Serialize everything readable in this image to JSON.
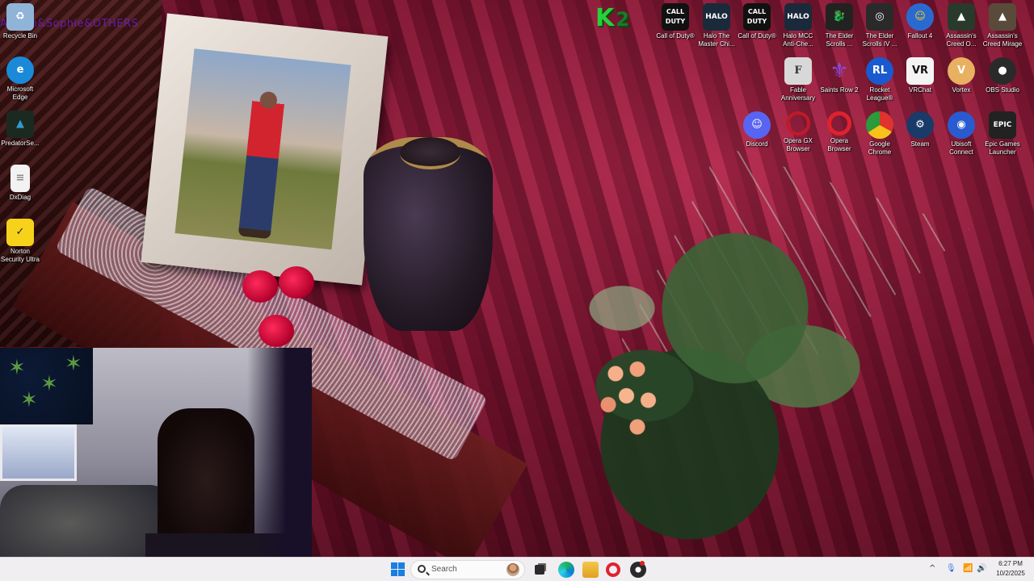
{
  "overlay_text": "Allison&Sophie&OTHERS",
  "logo": {
    "k": "K",
    "two": "2"
  },
  "desktop_left_icons": [
    {
      "name": "recycle-bin",
      "label": "Recycle Bin",
      "icon": "recycle-bin-icon",
      "color": "#8fb4d8"
    },
    {
      "name": "microsoft-edge",
      "label": "Microsoft Edge",
      "icon": "edge-icon",
      "color": "#1a8ad8"
    },
    {
      "name": "predatorsense",
      "label": "PredatorSe...",
      "icon": "predator-icon",
      "color": "#1a2a20"
    },
    {
      "name": "dxdiag",
      "label": "DxDiag",
      "icon": "document-icon",
      "color": "#f2f2f2"
    },
    {
      "name": "norton",
      "label": "Norton Security Ultra",
      "icon": "norton-icon",
      "color": "#f7d21a"
    }
  ],
  "desktop_right_row1": [
    {
      "name": "cod-1",
      "label": "Call of Duty®",
      "glyph": "CALL DUTY",
      "color": "#111111"
    },
    {
      "name": "halo-master-chief",
      "label": "Halo The Master Chi...",
      "glyph": "HALO",
      "color": "#1a2a3a"
    },
    {
      "name": "cod-2",
      "label": "Call of Duty®",
      "glyph": "CALL DUTY",
      "color": "#111111"
    },
    {
      "name": "halo-mcc-anticheat",
      "label": "Halo MCC Anti-Che...",
      "glyph": "HALO",
      "color": "#1a2a3a"
    },
    {
      "name": "elder-scrolls-1",
      "label": "The Elder Scrolls ...",
      "glyph": "ES",
      "color": "#222222"
    },
    {
      "name": "elder-scrolls-4",
      "label": "The Elder Scrolls IV ...",
      "glyph": "IV",
      "color": "#2a2a2a"
    },
    {
      "name": "fallout-4",
      "label": "Fallout 4",
      "glyph": "F4",
      "color": "#2a6ad0"
    },
    {
      "name": "assassins-creed-o",
      "label": "Assassin's Creed O...",
      "glyph": "AC",
      "color": "#2a3a2a"
    },
    {
      "name": "assassins-creed-mirage",
      "label": "Assassin's Creed Mirage",
      "glyph": "AC",
      "color": "#5a4a3a"
    }
  ],
  "desktop_right_row2": [
    {
      "name": "fable",
      "label": "Fable Anniversary",
      "glyph": "F",
      "color": "#d8d8d8"
    },
    {
      "name": "saints-row-2",
      "label": "Saints Row 2",
      "glyph": "⚜",
      "color": "#5a2a9a"
    },
    {
      "name": "rocket-league",
      "label": "Rocket League®",
      "glyph": "RL",
      "color": "#1a5ad0"
    },
    {
      "name": "vrchat",
      "label": "VRChat",
      "glyph": "VR",
      "color": "#f4f4f4"
    },
    {
      "name": "vortex",
      "label": "Vortex",
      "glyph": "V",
      "color": "#e8b060"
    },
    {
      "name": "obs-studio",
      "label": "OBS Studio",
      "glyph": "●",
      "color": "#2a2a2a"
    }
  ],
  "desktop_right_row3": [
    {
      "name": "discord",
      "label": "Discord",
      "glyph": "D",
      "color": "#5865f2"
    },
    {
      "name": "opera-gx",
      "label": "Opera GX Browser",
      "glyph": "O",
      "color": "#c01a2a"
    },
    {
      "name": "opera",
      "label": "Opera Browser",
      "glyph": "O",
      "color": "#e0222e"
    },
    {
      "name": "google-chrome",
      "label": "Google Chrome",
      "glyph": "●",
      "color": "#3a9a3a"
    },
    {
      "name": "steam",
      "label": "Steam",
      "glyph": "S",
      "color": "#1a3a6a"
    },
    {
      "name": "ubisoft-connect",
      "label": "Ubisoft Connect",
      "glyph": "U",
      "color": "#2a5ad0"
    },
    {
      "name": "epic-games",
      "label": "Epic Games Launcher",
      "glyph": "EPIC",
      "color": "#222222"
    }
  ],
  "taskbar": {
    "search_label": "Search",
    "time": "6:27 PM",
    "date": "10/2/2025",
    "tray_chevron": "^"
  }
}
